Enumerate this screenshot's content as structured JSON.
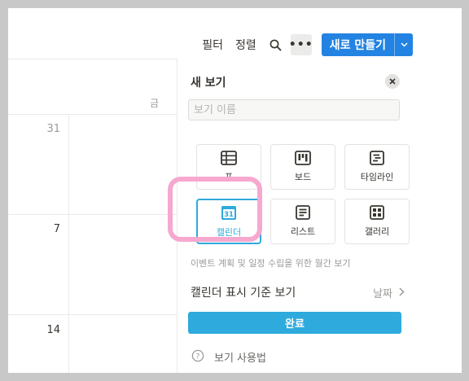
{
  "toolbar": {
    "filter_label": "필터",
    "sort_label": "정렬",
    "more_label": "•••",
    "new_label": "새로 만들기"
  },
  "calendar": {
    "day_header": "금",
    "dates": [
      "31",
      "7",
      "14"
    ]
  },
  "panel": {
    "title": "새 보기",
    "name_placeholder": "보기 이름",
    "options": [
      {
        "label": "표",
        "icon": "table-icon"
      },
      {
        "label": "보드",
        "icon": "board-icon"
      },
      {
        "label": "타임라인",
        "icon": "timeline-icon"
      },
      {
        "label": "캘린더",
        "icon": "calendar-icon",
        "icon_text": "31",
        "selected": true
      },
      {
        "label": "리스트",
        "icon": "list-icon"
      },
      {
        "label": "갤러리",
        "icon": "gallery-icon"
      }
    ],
    "description": "이벤트 계획 및 일정 수립을 위한 월간 보기",
    "basis_label": "캘린더 표시 기준 보기",
    "basis_value": "날짜",
    "done_label": "완료",
    "help_label": "보기 사용법"
  },
  "colors": {
    "accent": "#2eaadc",
    "new_button": "#2383e2",
    "highlight": "#f7a8cf",
    "text": "#37352f",
    "muted": "#9b9a97"
  }
}
